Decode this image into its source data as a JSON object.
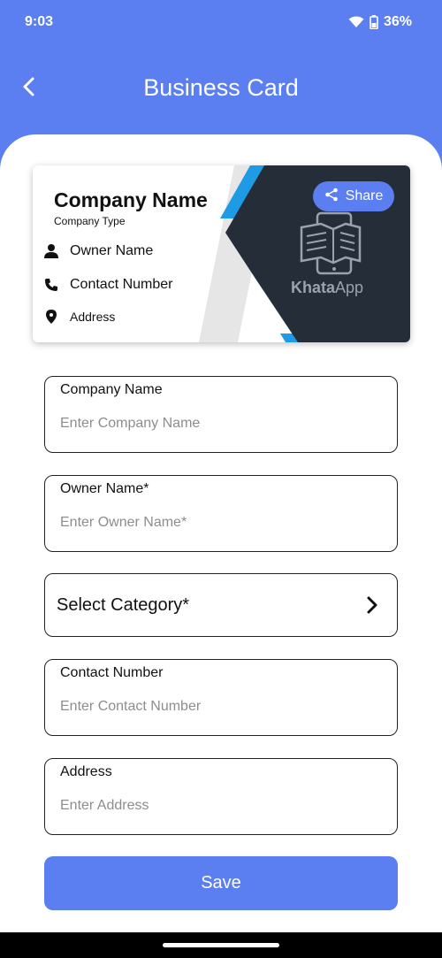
{
  "status_bar": {
    "time": "9:03",
    "battery": "36%"
  },
  "app_bar": {
    "title": "Business Card"
  },
  "card": {
    "company_name": "Company Name",
    "company_type": "Company Type",
    "owner": "Owner Name",
    "contact": "Contact Number",
    "address": "Address",
    "share_label": "Share",
    "logo_text_bold": "Khata",
    "logo_text_rest": "App"
  },
  "form": {
    "company_name": {
      "label": "Company Name",
      "placeholder": "Enter Company Name",
      "value": ""
    },
    "owner_name": {
      "label": "Owner Name*",
      "placeholder": "Enter Owner Name*",
      "value": ""
    },
    "category": {
      "label": "Select Category*"
    },
    "contact_number": {
      "label": "Contact Number",
      "placeholder": "Enter Contact Number",
      "value": ""
    },
    "address": {
      "label": "Address",
      "placeholder": "Enter Address",
      "value": ""
    }
  },
  "save_label": "Save",
  "colors": {
    "primary": "#5b7ef0",
    "card_dark": "#242d38",
    "card_accent": "#1f9be6"
  },
  "icons": [
    "back-arrow-icon",
    "wifi-icon",
    "battery-icon",
    "share-icon",
    "person-icon",
    "phone-icon",
    "location-pin-icon",
    "book-logo-icon",
    "chevron-right-icon"
  ]
}
